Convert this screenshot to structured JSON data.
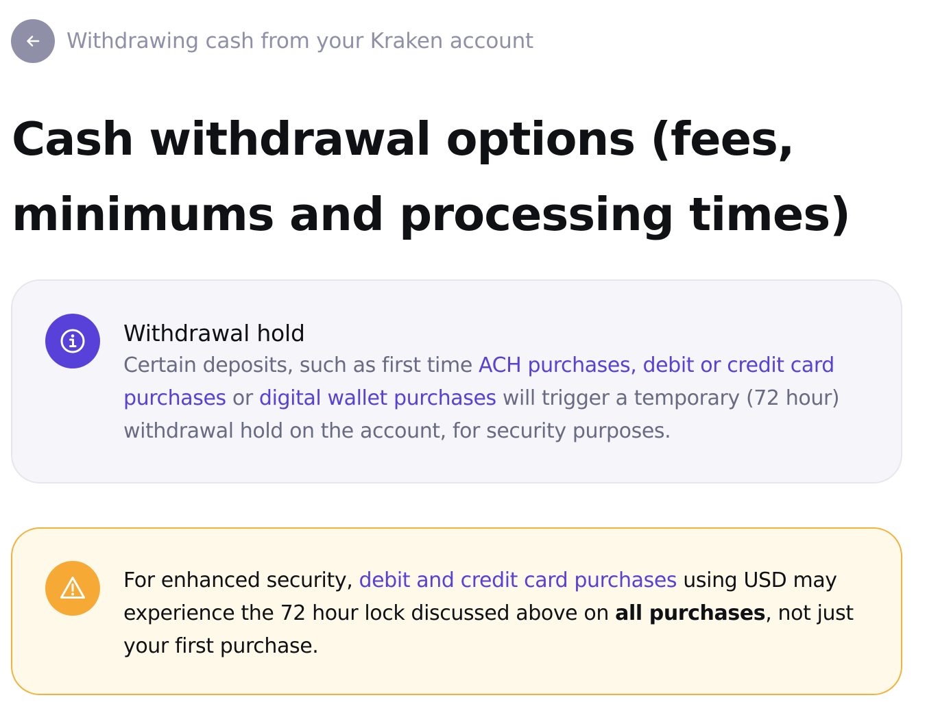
{
  "breadcrumb": {
    "back_icon": "arrow-left-icon",
    "label": "Withdrawing cash from your Kraken account"
  },
  "page": {
    "title": "Cash withdrawal options (fees, minimums and processing times)"
  },
  "info_callout": {
    "icon": "info-icon",
    "heading": "Withdrawal hold",
    "text_1": "Certain deposits, such as first time ",
    "link_1": "ACH purchases",
    "text_2": ", ",
    "link_2": "debit or credit card purchases",
    "text_3": " or ",
    "link_3": "digital wallet purchases",
    "text_4": " will trigger a temporary (72 hour) withdrawal hold on the account, for security purposes."
  },
  "warning_callout": {
    "icon": "warning-triangle-icon",
    "text_1": "For enhanced security, ",
    "link_1": "debit and credit card purchases",
    "text_2": " using USD may experience the 72 hour lock discussed above on ",
    "bold_1": "all purchases",
    "text_3": ", not just your first purchase."
  },
  "colors": {
    "accent": "#5741d9",
    "muted": "#8f90a8",
    "warning": "#f7a935",
    "info_bg": "#f5f5fa",
    "warning_bg": "#fff9ea"
  }
}
